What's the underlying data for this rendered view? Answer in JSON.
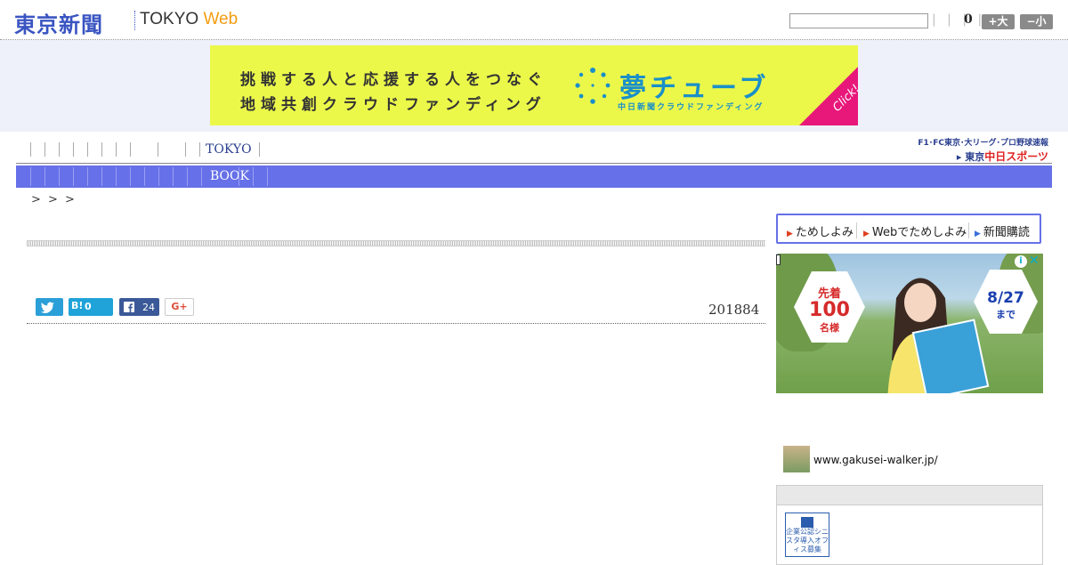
{
  "header": {
    "logo_ja": "東京新聞",
    "logo_en_main": "TOKYO",
    "logo_en_web": "Web",
    "search_value": "",
    "tiny_links": "| | | |",
    "count": "0",
    "font_large_label": "+大",
    "font_small_label": "−小"
  },
  "banner": {
    "line1": "挑戦する人と応援する人をつなぐ",
    "line2": "地域共創クラウドファンディング",
    "brand": "夢チューブ",
    "brand_sub": "中日新聞クラウドファンディング",
    "click": "Click!",
    "bg_color": "#ebf84a",
    "accent_color": "#e8177a"
  },
  "nav": {
    "tokyo_label": "TOKYO",
    "chunichi_top": "F1･FC東京･大リーグ･プロ野球速報",
    "chunichi_prefix": "東京",
    "chunichi_name": "中日スポーツ",
    "subnav_label": "BOOK",
    "subnav_color": "#6670e8"
  },
  "breadcrumb": {
    "text": ">  > >"
  },
  "article": {
    "hatena_count": "0",
    "hatena_label": "B!",
    "facebook_count": "24",
    "gplus_label": "G+",
    "date": "201884"
  },
  "sidebar": {
    "subscribe_items": [
      {
        "label": "ためしよみ"
      },
      {
        "label": "Webでためしよみ"
      },
      {
        "label": "新聞購読"
      }
    ],
    "ad": {
      "badge1_top": "先着",
      "badge1_num": "100",
      "badge1_bottom": "名様",
      "badge2_date": "8/27",
      "badge2_suffix": "まで",
      "info": "i",
      "close": "✕"
    },
    "gw_link": "www.gakusei-walker.jp/",
    "badge_text": "企業公認シニスタ導入オフィス募集"
  }
}
